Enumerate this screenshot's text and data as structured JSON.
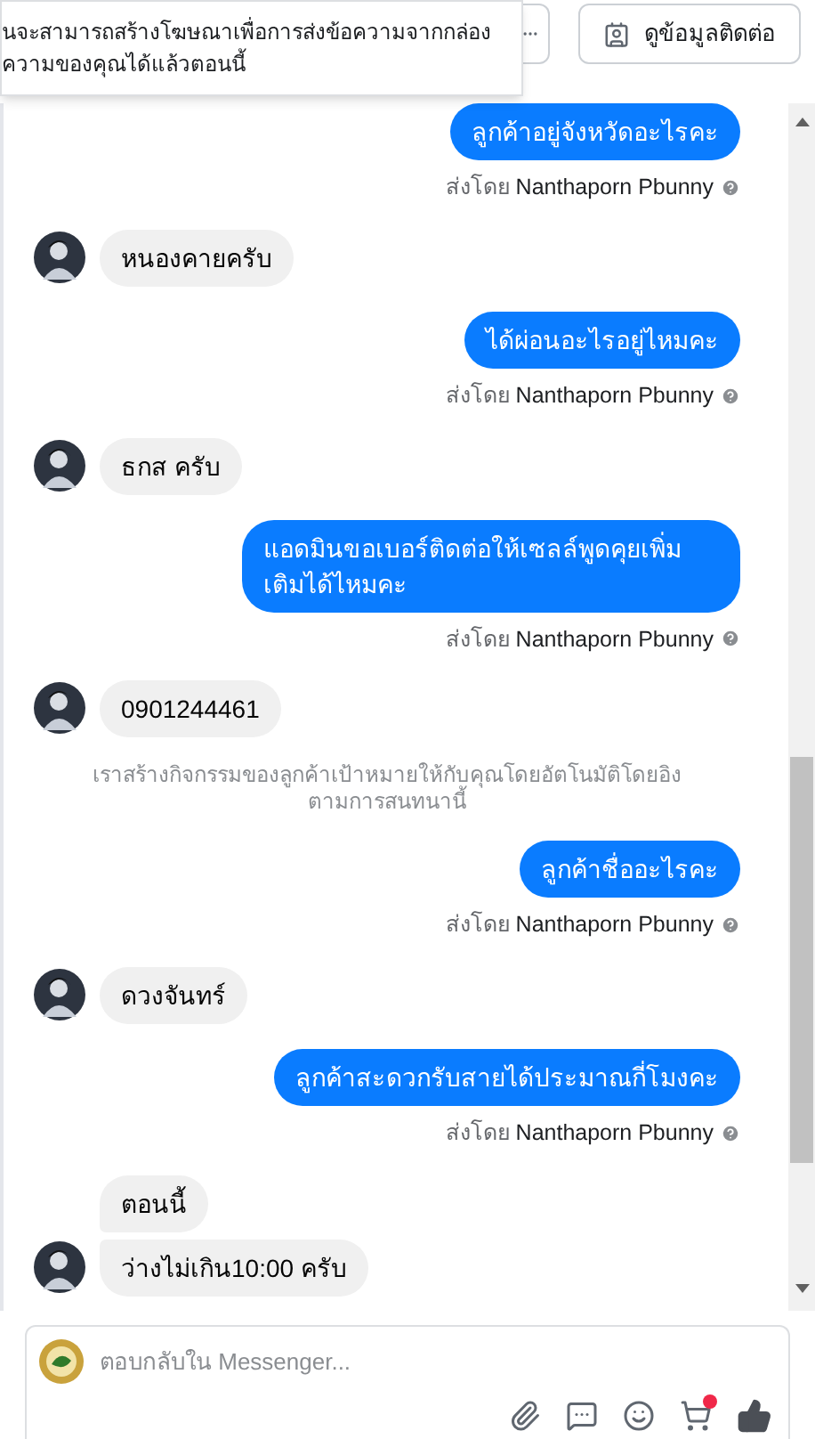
{
  "toolbar": {
    "contact_button": "ดูข้อมูลติดต่อ"
  },
  "tooltip": {
    "lines": [
      "นจะสามารถสร้างโฆษณาเพื่อการส่งข้อความจากกล่อง",
      "ความของคุณได้แล้วตอนนี้"
    ]
  },
  "messages": [
    {
      "kind": "outgoing",
      "text": "ลูกค้าอยู่จังหวัดอะไรคะ",
      "sent_by": "ส่งโดย",
      "sender": "Nanthaporn Pbunny"
    },
    {
      "kind": "incoming",
      "texts": [
        "หนองคายครับ"
      ]
    },
    {
      "kind": "outgoing",
      "text": "ได้ผ่อนอะไรอยู่ไหมคะ",
      "sent_by": "ส่งโดย",
      "sender": "Nanthaporn Pbunny"
    },
    {
      "kind": "incoming",
      "texts": [
        "ธกส ครับ"
      ]
    },
    {
      "kind": "outgoing",
      "text": "แอดมินขอเบอร์ติดต่อให้เซลล์พูดคุยเพิ่มเติมได้ไหมคะ",
      "sent_by": "ส่งโดย",
      "sender": "Nanthaporn Pbunny"
    },
    {
      "kind": "incoming",
      "texts": [
        "0901244461"
      ]
    },
    {
      "kind": "note",
      "text": "เราสร้างกิจกรรมของลูกค้าเป้าหมายให้กับคุณโดยอัตโนมัติโดยอิงตามการสนทนานี้"
    },
    {
      "kind": "outgoing",
      "text": "ลูกค้าชื่ออะไรคะ",
      "sent_by": "ส่งโดย",
      "sender": "Nanthaporn Pbunny"
    },
    {
      "kind": "incoming",
      "texts": [
        "ดวงจันทร์"
      ]
    },
    {
      "kind": "outgoing",
      "text": "ลูกค้าสะดวกรับสายได้ประมาณกี่โมงคะ",
      "sent_by": "ส่งโดย",
      "sender": "Nanthaporn Pbunny"
    },
    {
      "kind": "incoming",
      "texts": [
        "ตอนนี้",
        "ว่างไม่เกิน10:00 ครับ"
      ]
    }
  ],
  "composer": {
    "placeholder": "ตอบกลับใน Messenger...",
    "cart_notification": true
  }
}
